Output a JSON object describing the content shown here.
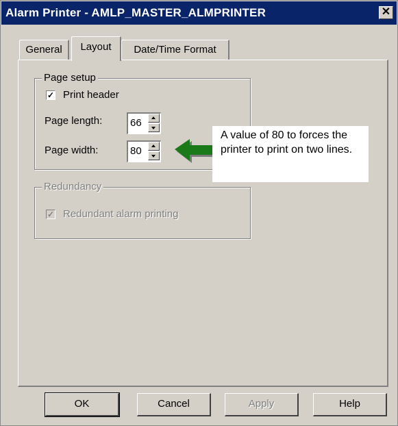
{
  "window": {
    "title": "Alarm Printer - AMLP_MASTER_ALMPRINTER",
    "close_glyph": "✕"
  },
  "tabs": [
    {
      "label": "General",
      "selected": false
    },
    {
      "label": "Layout",
      "selected": true
    },
    {
      "label": "Date/Time Format",
      "selected": false
    }
  ],
  "page_setup": {
    "legend": "Page setup",
    "print_header_label": "Print header",
    "print_header_checked": true,
    "page_length_label": "Page length:",
    "page_length_value": "66",
    "page_width_label": "Page width:",
    "page_width_value": "80"
  },
  "redundancy": {
    "legend": "Redundancy",
    "redundant_label": "Redundant alarm printing",
    "redundant_checked": true,
    "enabled": false
  },
  "callout": {
    "text": "A value of 80 to forces the printer to print on two lines.",
    "arrow_color": "#1a7a1a"
  },
  "buttons": {
    "ok": "OK",
    "cancel": "Cancel",
    "apply": "Apply",
    "help": "Help"
  },
  "colors": {
    "titlebar": "#0a246a",
    "face": "#d4d0c8"
  }
}
